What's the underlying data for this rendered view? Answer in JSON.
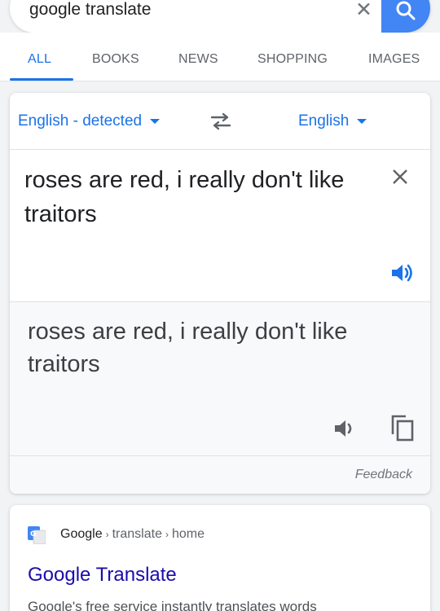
{
  "search": {
    "query": "google translate"
  },
  "tabs": [
    {
      "label": "ALL",
      "active": true
    },
    {
      "label": "BOOKS"
    },
    {
      "label": "NEWS"
    },
    {
      "label": "SHOPPING"
    },
    {
      "label": "IMAGES"
    }
  ],
  "translate": {
    "source_lang": "English - detected",
    "target_lang": "English",
    "source_text": "roses are red, i really don't like traitors",
    "translated_text": "roses are red, i really don't like traitors",
    "feedback_label": "Feedback"
  },
  "result": {
    "breadcrumb_site": "Google",
    "breadcrumb_parts": [
      "translate",
      "home"
    ],
    "title": "Google Translate",
    "snippet": "Google's free service instantly translates words"
  },
  "colors": {
    "accent": "#1a73e8",
    "search_button": "#4285f4",
    "link": "#1a0dab"
  },
  "icons": [
    "clear-icon",
    "search-icon",
    "dropdown-caret-icon",
    "swap-languages-icon",
    "close-icon",
    "speaker-icon",
    "copy-icon",
    "google-translate-favicon"
  ]
}
